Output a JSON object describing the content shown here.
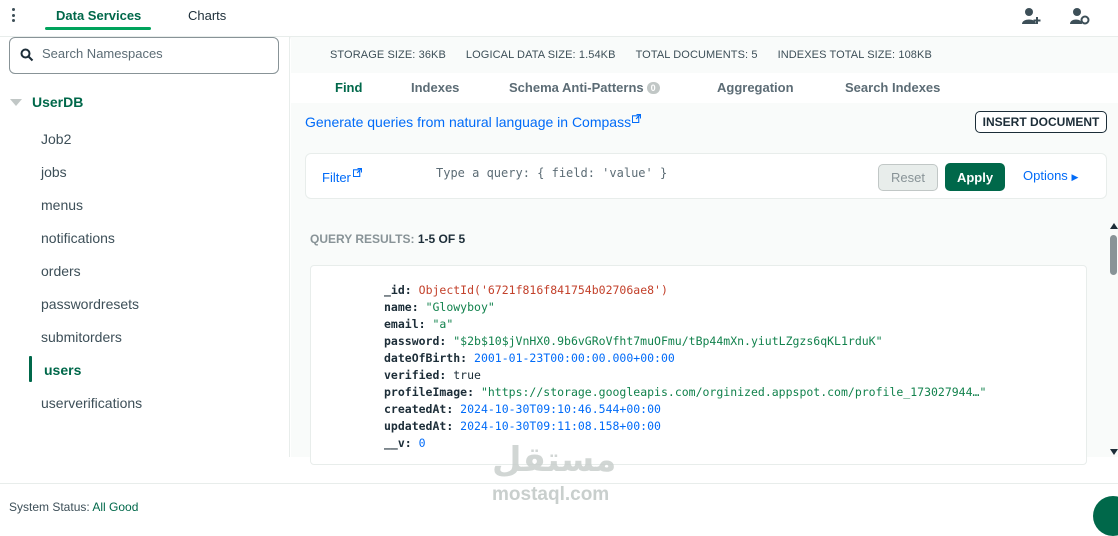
{
  "topbar": {
    "tab_data_services": "Data Services",
    "tab_charts": "Charts"
  },
  "sidebar": {
    "search_placeholder": "Search Namespaces",
    "database": "UserDB",
    "collections": [
      "Job2",
      "jobs",
      "menus",
      "notifications",
      "orders",
      "passwordresets",
      "submitorders",
      "users",
      "userverifications"
    ],
    "active_collection": "users"
  },
  "stats": {
    "storage": "STORAGE SIZE: 36KB",
    "logical": "LOGICAL DATA SIZE: 1.54KB",
    "documents": "TOTAL DOCUMENTS: 5",
    "indexes": "INDEXES TOTAL SIZE: 108KB"
  },
  "tabs": {
    "find": "Find",
    "indexes": "Indexes",
    "schema": "Schema Anti-Patterns",
    "schema_badge": "0",
    "aggregation": "Aggregation",
    "search_indexes": "Search Indexes"
  },
  "compass_link": "Generate queries from natural language in Compass",
  "insert_document": "INSERT DOCUMENT",
  "filter": {
    "label": "Filter",
    "placeholder": "Type a query: { field: 'value' }",
    "reset": "Reset",
    "apply": "Apply",
    "options": "Options"
  },
  "results": {
    "label": "QUERY RESULTS:",
    "range": "1-5 OF 5"
  },
  "document": {
    "id_key": "_id",
    "id_val": "ObjectId('6721f816f841754b02706ae8')",
    "name_key": "name",
    "name_val": "\"Glowyboy\"",
    "email_key": "email",
    "email_val": "\"a\"",
    "password_key": "password",
    "password_val": "\"$2b$10$jVnHX0.9b6vGRoVfht7muOFmu/tBp44mXn.yiutLZgzs6qKL1rduK\"",
    "dob_key": "dateOfBirth",
    "dob_val": "2001-01-23T00:00:00.000+00:00",
    "verified_key": "verified",
    "verified_val": "true",
    "profile_key": "profileImage",
    "profile_val": "\"https://storage.googleapis.com/orginized.appspot.com/profile_173027944…\"",
    "created_key": "createdAt",
    "created_val": "2024-10-30T09:10:46.544+00:00",
    "updated_key": "updatedAt",
    "updated_val": "2024-10-30T09:11:08.158+00:00",
    "v_key": "__v",
    "v_val": "0"
  },
  "footer": {
    "status_label": "System Status:",
    "status_value": "All Good"
  },
  "watermark": {
    "arabic": "مستقل",
    "latin": "mostaql.com"
  },
  "colors": {
    "brand_green": "#00684a",
    "link_blue": "#016bf8",
    "accent_green": "#00a35c"
  }
}
